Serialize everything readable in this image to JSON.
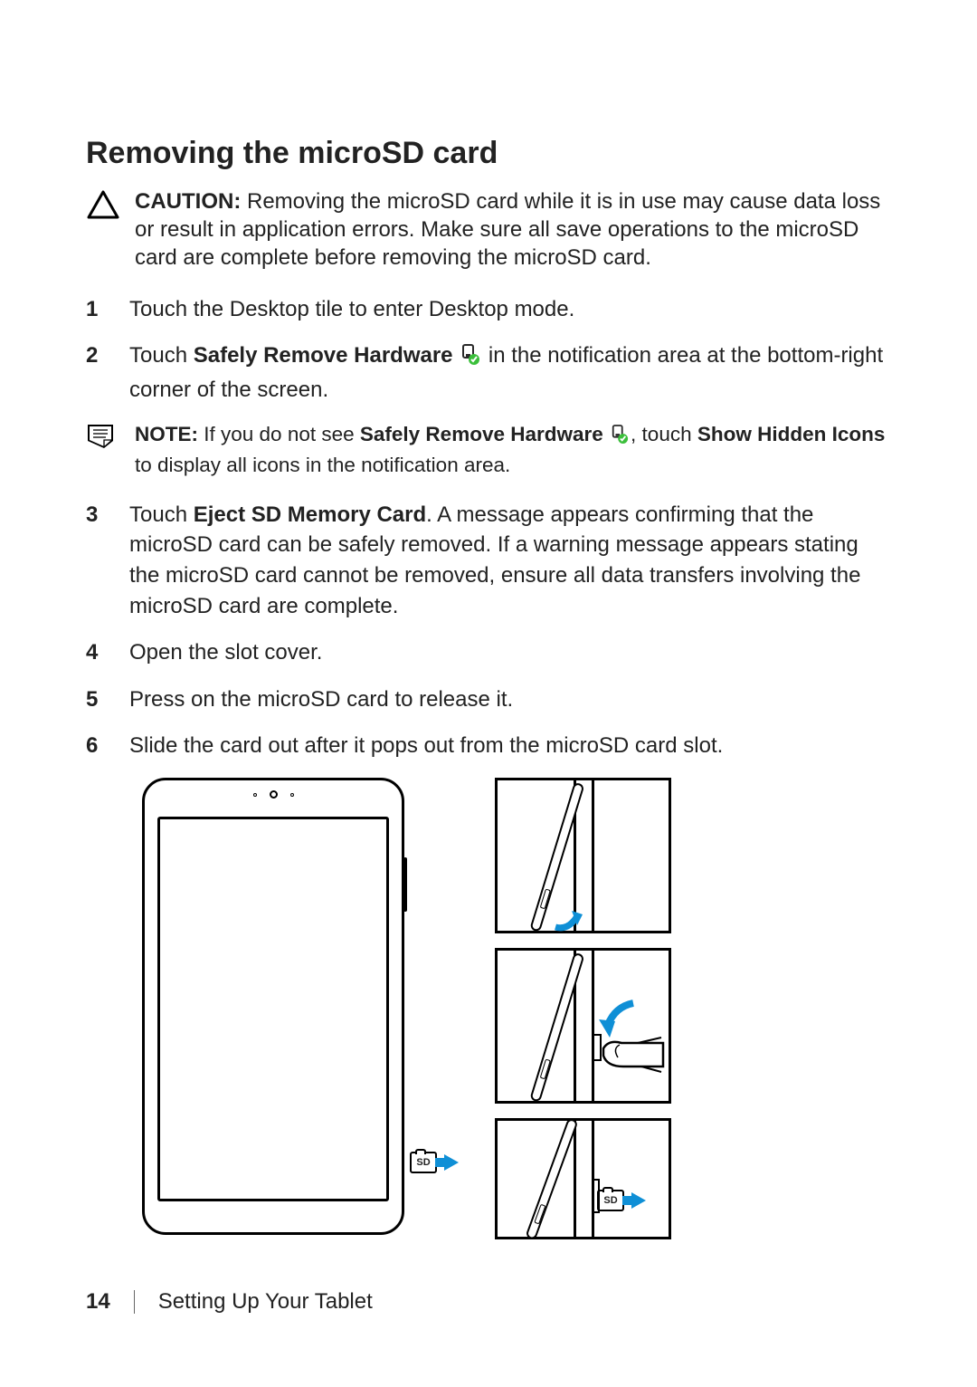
{
  "title": "Removing the microSD card",
  "caution": {
    "label": "CAUTION:",
    "text": "Removing the microSD card while it is in use may cause data loss or result in application errors. Make sure all save operations to the microSD card are complete before removing the microSD card."
  },
  "steps_a": {
    "s1": "Touch the Desktop tile to enter Desktop mode.",
    "s2_a": "Touch ",
    "s2_bold": "Safely Remove Hardware",
    "s2_b": " in the notification area at the bottom-right corner of the screen."
  },
  "note": {
    "label": "NOTE:",
    "t1": "If you do not see ",
    "bold1": "Safely Remove Hardware",
    "t2": ", touch ",
    "bold2": "Show Hidden Icons",
    "t3": " to display all icons in the notification area."
  },
  "steps_b": {
    "s3_a": "Touch ",
    "s3_bold": "Eject SD Memory Card",
    "s3_b": ". A message appears confirming that the microSD card can be safely removed. If a warning message appears stating the microSD card cannot be removed, ensure all data transfers involving the microSD card are complete.",
    "s4": "Open the slot cover.",
    "s5": "Press on the microSD card to release it.",
    "s6": "Slide the card out after it pops out from the microSD card slot."
  },
  "sd_label": "SD",
  "footer": {
    "page": "14",
    "section": "Setting Up Your Tablet"
  }
}
